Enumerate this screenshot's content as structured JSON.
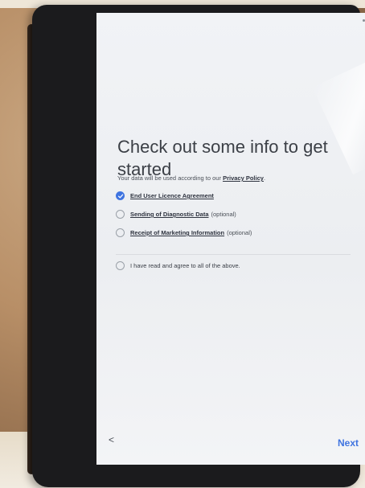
{
  "screen": {
    "title": "Check out some info to get started",
    "intro_text": "Your data will be used according to our ",
    "privacy_link": "Privacy Policy",
    "intro_end": ".",
    "options": [
      {
        "label": "End User Licence Agreement",
        "suffix": "",
        "checked": true
      },
      {
        "label": "Sending of Diagnostic Data",
        "suffix": "(optional)",
        "checked": false
      },
      {
        "label": "Receipt of Marketing Information",
        "suffix": "(optional)",
        "checked": false
      }
    ],
    "agree_all_label": "I have read and agree to all of the above.",
    "agree_all_checked": false,
    "back_glyph": "<",
    "next_label": "Next"
  },
  "colors": {
    "accent": "#3f74e0",
    "title_text": "#3b3f46",
    "screen_bg": "#eceef1"
  },
  "icons": [
    "check-icon",
    "back-arrow-icon"
  ]
}
